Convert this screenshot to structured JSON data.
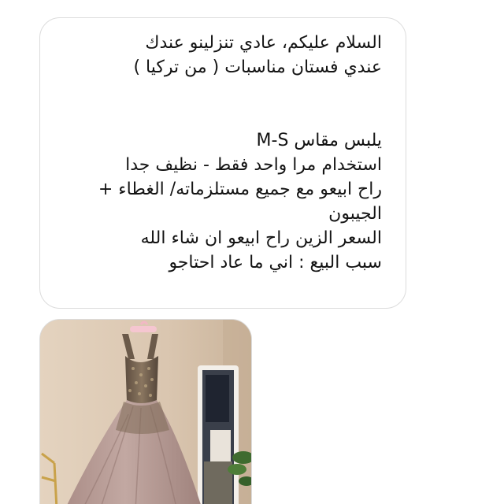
{
  "message": {
    "lines": [
      "السلام عليكم، عادي تنزلينو عندك",
      "عندي فستان مناسبات ( من تركيا )",
      "",
      "يلبس مقاس M-S",
      "استخدام مرا واحد فقط - نظيف جدا",
      "راح ابيعو مع جميع مستلزماته/ الغطاء +",
      "الجيبون",
      "السعر الزين راح ابيعو ان شاء الله",
      "سبب البيع : اني ما عاد احتاجو"
    ]
  },
  "attachment": {
    "type": "photo",
    "subject": "dress-on-hanger",
    "colors": {
      "wall": "#dcc8b2",
      "dress_bodice": "#6b5a4a",
      "dress_skirt": "#b89d96",
      "mirror_frame": "#f2eee8",
      "bubble_border": "#dcdcdc"
    }
  }
}
